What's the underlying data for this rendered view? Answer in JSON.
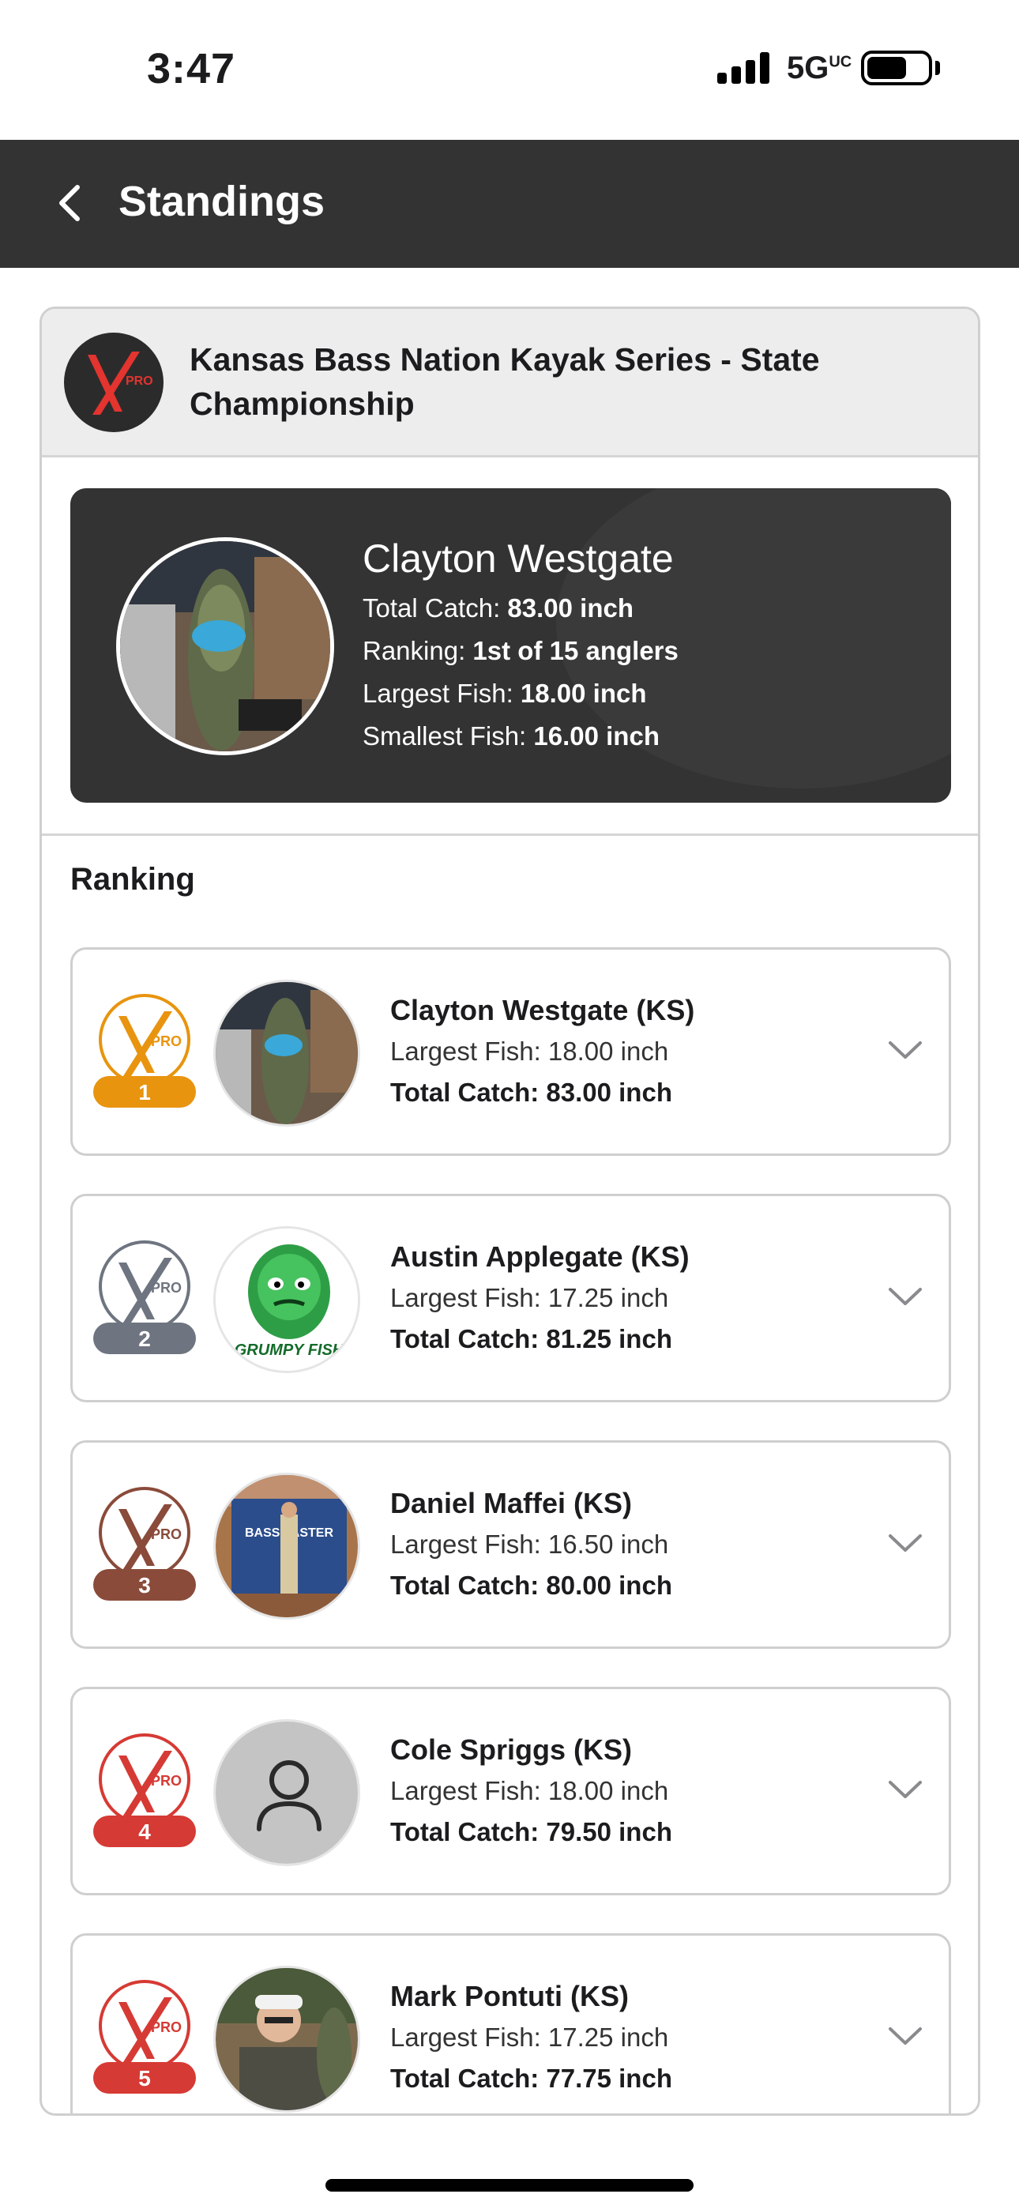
{
  "status_bar": {
    "time": "3:47",
    "network": "5G",
    "network_suffix": "UC"
  },
  "header": {
    "title": "Standings"
  },
  "event": {
    "logo_text": "PRO",
    "title": "Kansas Bass Nation Kayak Series - State Championship"
  },
  "summary": {
    "name": "Clayton Westgate",
    "total_label": "Total Catch: ",
    "total_value": "83.00 inch",
    "ranking_label": "Ranking: ",
    "ranking_value": "1st of 15 anglers",
    "largest_label": "Largest Fish: ",
    "largest_value": "18.00 inch",
    "smallest_label": "Smallest Fish: ",
    "smallest_value": "16.00 inch"
  },
  "ranking": {
    "title": "Ranking",
    "rows": [
      {
        "rank": "1",
        "badge_color": "#e8940f",
        "badge_text": "PRO",
        "name": "Clayton Westgate (KS)",
        "largest": "Largest Fish: 18.00 inch",
        "total": "Total Catch: 83.00 inch",
        "avatar": "fish-photo"
      },
      {
        "rank": "2",
        "badge_color": "#6e7580",
        "badge_text": "PRO",
        "name": "Austin Applegate (KS)",
        "largest": "Largest Fish: 17.25 inch",
        "total": "Total Catch: 81.25 inch",
        "avatar": "grumpy-fish-logo",
        "avatar_text": "GRUMPY FISH"
      },
      {
        "rank": "3",
        "badge_color": "#8a4b3a",
        "badge_text": "PRO",
        "name": "Daniel Maffei (KS)",
        "largest": "Largest Fish: 16.50 inch",
        "total": "Total Catch: 80.00 inch",
        "avatar": "bassmaster-photo",
        "avatar_text": "BASSMASTER"
      },
      {
        "rank": "4",
        "badge_color": "#d63a34",
        "badge_text": "PRO",
        "name": "Cole Spriggs (KS)",
        "largest": "Largest Fish: 18.00 inch",
        "total": "Total Catch: 79.50 inch",
        "avatar": "default-user"
      },
      {
        "rank": "5",
        "badge_color": "#d63a34",
        "badge_text": "PRO",
        "name": "Mark Pontuti (KS)",
        "largest": "Largest Fish: 17.25 inch",
        "total": "Total Catch: 77.75 inch",
        "avatar": "angler-photo"
      }
    ]
  }
}
